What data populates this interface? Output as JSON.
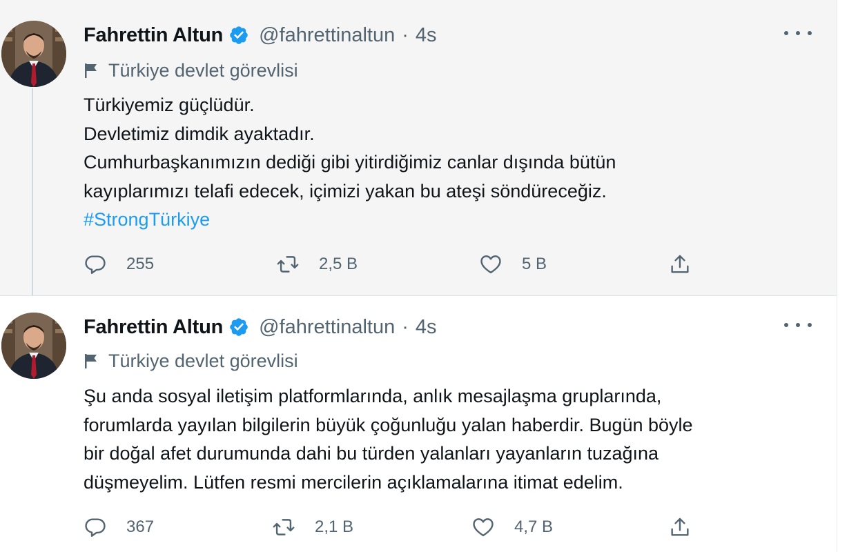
{
  "tweets": [
    {
      "author_name": "Fahrettin Altun",
      "handle": "@fahrettinaltun",
      "separator": "·",
      "time": "4s",
      "label": "Türkiye devlet görevlisi",
      "lines": [
        "Türkiyemiz güçlüdür.",
        "Devletimiz dimdik ayaktadır.",
        "Cumhurbaşkanımızın dediği gibi yitirdiğimiz canlar dışında bütün",
        "kayıplarımızı telafi edecek, içimizi yakan bu ateşi söndüreceğiz."
      ],
      "hashtag": "#StrongTürkiye",
      "replies": "255",
      "retweets": "2,5 B",
      "likes": "5 B"
    },
    {
      "author_name": "Fahrettin Altun",
      "handle": "@fahrettinaltun",
      "separator": "·",
      "time": "4s",
      "label": "Türkiye devlet görevlisi",
      "lines": [
        "Şu anda sosyal iletişim platformlarında, anlık mesajlaşma gruplarında,",
        "forumlarda yayılan bilgilerin büyük çoğunluğu yalan haberdir. Bugün böyle",
        "bir doğal afet durumunda dahi bu türden yalanları yayanların tuzağına",
        "düşmeyelim. Lütfen resmi mercilerin açıklamalarına itimat edelim."
      ],
      "replies": "367",
      "retweets": "2,1 B",
      "likes": "4,7 B"
    }
  ],
  "icons": {
    "verified": "verified-badge-icon",
    "label": "flag-icon",
    "more": "more-dots-icon",
    "reply": "reply-icon",
    "retweet": "retweet-icon",
    "like": "like-icon",
    "share": "share-icon"
  },
  "colors": {
    "accent": "#1d9bf0",
    "secondary_text": "#536471",
    "highlight_background": "#f5f5f5"
  }
}
